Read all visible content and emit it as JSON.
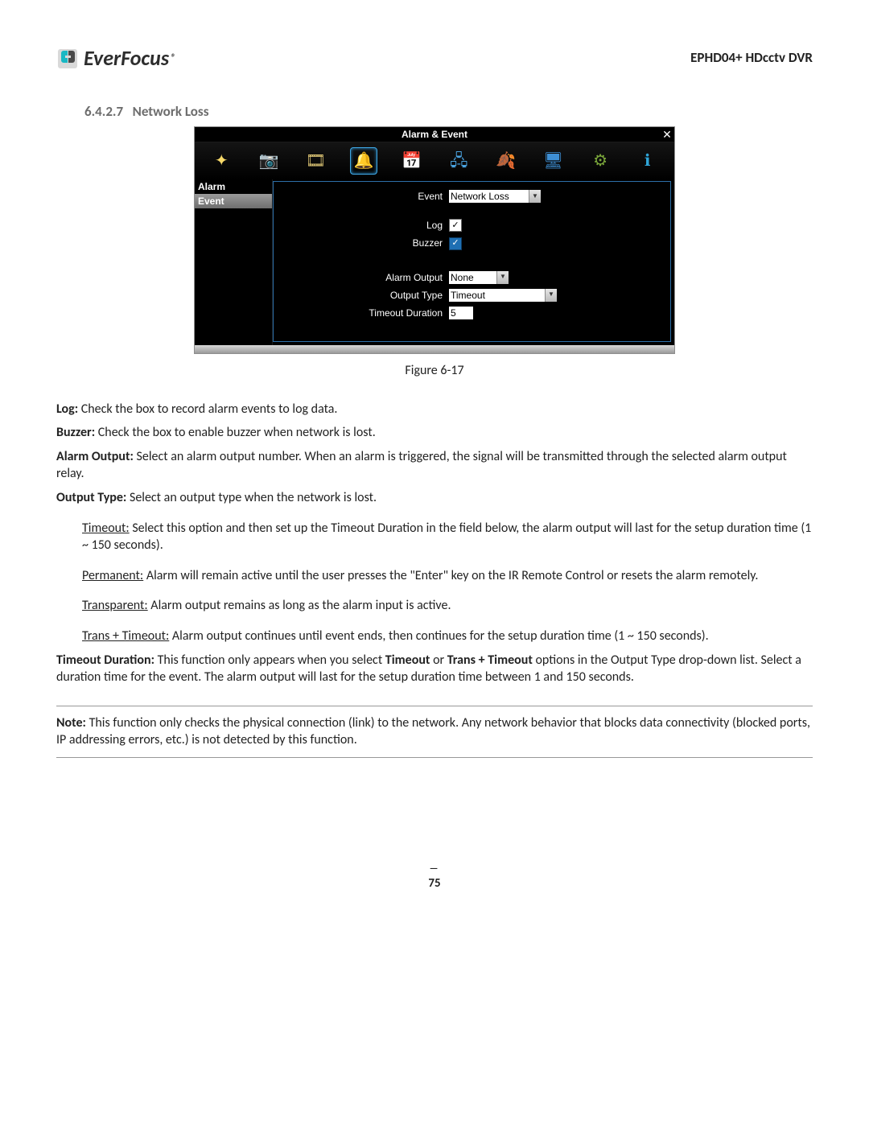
{
  "header": {
    "logo_text": "EverFocus",
    "logo_reg": "®",
    "product": "EPHD04+  HDcctv DVR"
  },
  "section": {
    "number": "6.4.2.7",
    "title": "Network Loss"
  },
  "screenshot": {
    "window_title": "Alarm & Event",
    "close_glyph": "✕",
    "toolbar_icons": [
      "sparkle-icon",
      "camera-icon",
      "film-icon",
      "bell-icon",
      "schedule-icon",
      "network-icon",
      "leaf-icon",
      "display-icon",
      "gear-icon",
      "info-icon"
    ],
    "toolbar_glyphs": [
      "✦",
      "📷",
      "🎞",
      "🔔",
      "📅",
      "🖧",
      "🍂",
      "🖥",
      "⚙",
      "ℹ"
    ],
    "sidebar": {
      "items": [
        "Alarm",
        "Event"
      ],
      "selected_index": 1
    },
    "fields": {
      "event_label": "Event",
      "event_value": "Network Loss",
      "log_label": "Log",
      "log_checked": true,
      "buzzer_label": "Buzzer",
      "buzzer_checked": true,
      "alarm_output_label": "Alarm Output",
      "alarm_output_value": "None",
      "output_type_label": "Output Type",
      "output_type_value": "Timeout",
      "timeout_label": "Timeout Duration",
      "timeout_value": "5"
    }
  },
  "figure_caption": "Figure 6-17",
  "body": {
    "log": {
      "label": "Log:",
      "text": " Check the box to record alarm events to log data."
    },
    "buzzer": {
      "label": "Buzzer:",
      "text": " Check the box to enable buzzer when network is lost."
    },
    "alarm_output": {
      "label": "Alarm Output:",
      "text": " Select an alarm output number. When an alarm is triggered, the signal will be transmitted through the selected alarm output relay."
    },
    "output_type": {
      "label": "Output Type:",
      "text": " Select an output type when the network is lost."
    },
    "timeout": {
      "label": "Timeout:",
      "text": " Select this option and then set up the Timeout Duration in the field below, the alarm output will last for the setup duration time (1 ~ 150 seconds)."
    },
    "permanent": {
      "label": "Permanent:",
      "text": " Alarm will remain active until the user presses the \"Enter\" key on the IR Remote Control or resets the alarm remotely."
    },
    "transparent": {
      "label": "Transparent:",
      "text": " Alarm output remains as long as the alarm input is active."
    },
    "trans_timeout": {
      "label": "Trans + Timeout:",
      "text": " Alarm output continues until event ends, then continues for the setup duration time (1 ~ 150 seconds)."
    },
    "timeout_duration": {
      "label": "Timeout Duration:",
      "text_a": " This function only appears when you select ",
      "kw1": "Timeout",
      "text_b": " or ",
      "kw2": "Trans + Timeout",
      "text_c": " options in the Output Type drop-down list. Select a duration time for the event. The alarm output will last for the setup duration time between 1 and 150 seconds."
    },
    "note": {
      "label": "Note:",
      "text": " This function only checks the physical connection (link) to the network. Any network behavior that blocks data connectivity (blocked ports, IP addressing errors, etc.) is not detected by this function."
    }
  },
  "page_number": "75"
}
